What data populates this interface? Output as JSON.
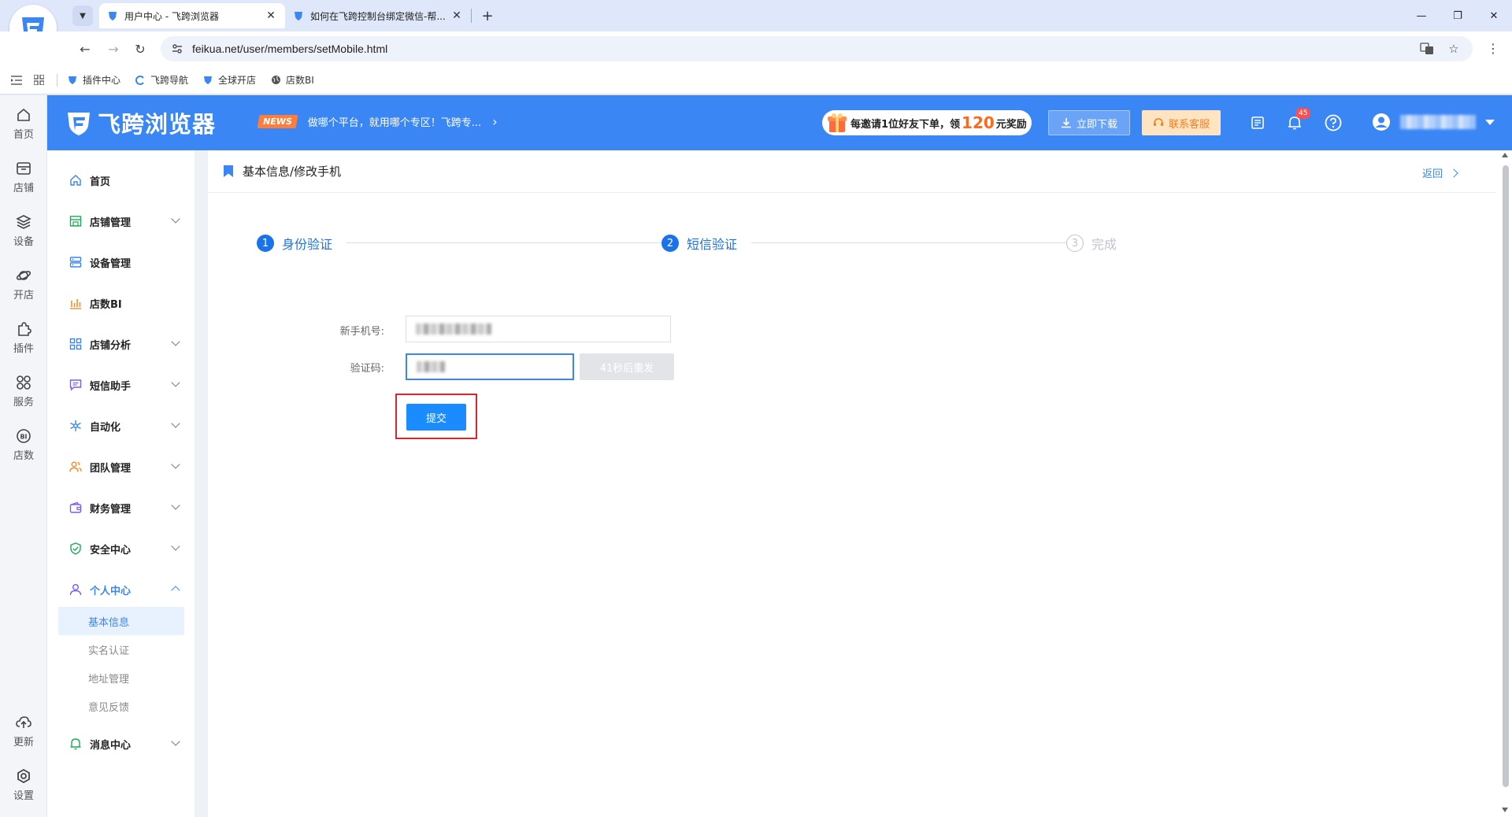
{
  "browser": {
    "tabs": [
      {
        "title": "用户中心 - 飞跨浏览器",
        "active": true
      },
      {
        "title": "如何在飞跨控制台绑定微信-帮...",
        "active": false
      }
    ],
    "close_glyph": "✕",
    "new_tab_glyph": "+",
    "window_controls": [
      "—",
      "❐",
      "✕"
    ],
    "url": "feikua.net/user/members/setMobile.html",
    "bookmarks": [
      "插件中心",
      "飞跨导航",
      "全球开店",
      "店数BI"
    ]
  },
  "rail": {
    "items": [
      "首页",
      "店铺",
      "设备",
      "开店",
      "插件",
      "服务",
      "店数"
    ],
    "bottom": [
      "更新",
      "设置"
    ]
  },
  "header": {
    "brand": "飞跨浏览器",
    "news_badge": "NEWS",
    "news_text": "做哪个平台，就用哪个专区！飞跨专...",
    "invite_prefix": "每邀请1位好友下单，领",
    "invite_amount": "120",
    "invite_suffix": "元奖励",
    "download_label": "立即下载",
    "service_label": "联系客服",
    "notification_count": "45"
  },
  "sidebar": {
    "items": [
      {
        "label": "首页"
      },
      {
        "label": "店铺管理"
      },
      {
        "label": "设备管理"
      },
      {
        "label": "店数BI"
      },
      {
        "label": "店铺分析"
      },
      {
        "label": "短信助手"
      },
      {
        "label": "自动化"
      },
      {
        "label": "团队管理"
      },
      {
        "label": "财务管理"
      },
      {
        "label": "安全中心"
      },
      {
        "label": "个人中心"
      },
      {
        "label": "消息中心"
      }
    ],
    "sub_items": [
      "基本信息",
      "实名认证",
      "地址管理",
      "意见反馈"
    ]
  },
  "main": {
    "breadcrumb": "基本信息/修改手机",
    "back_label": "返回",
    "steps": [
      {
        "num": "1",
        "label": "身份验证",
        "status": "done"
      },
      {
        "num": "2",
        "label": "短信验证",
        "status": "done"
      },
      {
        "num": "3",
        "label": "完成",
        "status": "todo"
      }
    ],
    "form": {
      "phone_label": "新手机号:",
      "code_label": "验证码:",
      "resend_label": "41秒后重发",
      "submit_label": "提交"
    }
  },
  "colors": {
    "primary": "#3b86f5",
    "submit": "#1a8cff",
    "highlight": "#e0242b",
    "accent_orange": "#ff7d1a"
  }
}
